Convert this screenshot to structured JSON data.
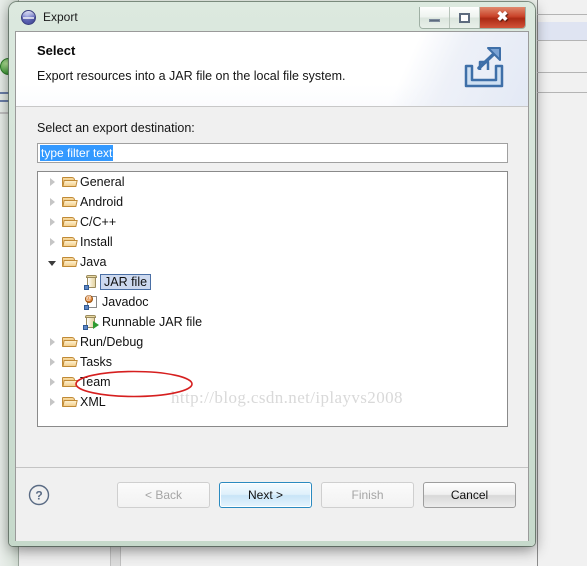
{
  "window": {
    "title": "Export",
    "icon": "eclipse-globe-icon",
    "controls": {
      "minimize": "minimize-icon",
      "maximize": "maximize-icon",
      "close": "close-icon"
    }
  },
  "header": {
    "title": "Select",
    "description": "Export resources into a JAR file on the local file system.",
    "icon": "export-arrow-icon"
  },
  "content": {
    "destination_label": "Select an export destination:",
    "filter": {
      "value": "type filter text",
      "placeholder": "type filter text",
      "selected": true,
      "selection_color": "#3399ff"
    },
    "tree": [
      {
        "label": "General",
        "icon": "folder-icon",
        "level": 0,
        "state": "collapsed",
        "selected": false
      },
      {
        "label": "Android",
        "icon": "folder-icon",
        "level": 0,
        "state": "collapsed",
        "selected": false
      },
      {
        "label": "C/C++",
        "icon": "folder-icon",
        "level": 0,
        "state": "collapsed",
        "selected": false
      },
      {
        "label": "Install",
        "icon": "folder-icon",
        "level": 0,
        "state": "collapsed",
        "selected": false
      },
      {
        "label": "Java",
        "icon": "folder-icon",
        "level": 0,
        "state": "expanded",
        "selected": false
      },
      {
        "label": "JAR file",
        "icon": "jar-file-icon",
        "level": 1,
        "state": "leaf",
        "selected": true
      },
      {
        "label": "Javadoc",
        "icon": "javadoc-icon",
        "level": 1,
        "state": "leaf",
        "selected": false
      },
      {
        "label": "Runnable JAR file",
        "icon": "runnable-jar-icon",
        "level": 1,
        "state": "leaf",
        "selected": false
      },
      {
        "label": "Run/Debug",
        "icon": "folder-icon",
        "level": 0,
        "state": "collapsed",
        "selected": false
      },
      {
        "label": "Tasks",
        "icon": "folder-icon",
        "level": 0,
        "state": "collapsed",
        "selected": false
      },
      {
        "label": "Team",
        "icon": "folder-icon",
        "level": 0,
        "state": "collapsed",
        "selected": false
      },
      {
        "label": "XML",
        "icon": "folder-icon",
        "level": 0,
        "state": "collapsed",
        "selected": false
      }
    ]
  },
  "annotation": {
    "watermark": "http://blog.csdn.net/iplayvs2008",
    "highlight_color": "#d61f1f",
    "highlight_target": "JAR file"
  },
  "footer": {
    "help": "help-icon",
    "buttons": [
      {
        "label": "< Back",
        "state": "disabled",
        "name": "back-button"
      },
      {
        "label": "Next >",
        "state": "default",
        "name": "next-button"
      },
      {
        "label": "Finish",
        "state": "disabled",
        "name": "finish-button"
      },
      {
        "label": "Cancel",
        "state": "normal",
        "name": "cancel-button"
      }
    ]
  }
}
